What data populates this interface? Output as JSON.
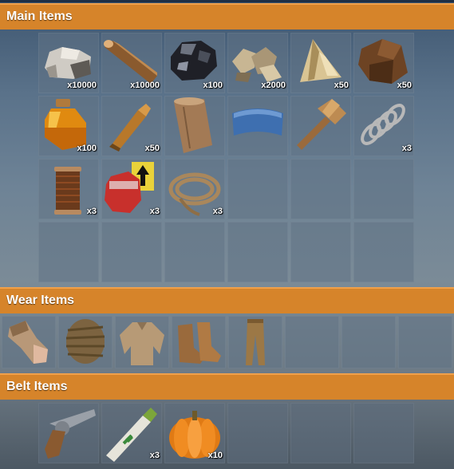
{
  "sections": {
    "main": {
      "title": "Main Items"
    },
    "wear": {
      "title": "Wear Items"
    },
    "belt": {
      "title": "Belt Items"
    }
  },
  "main_items": [
    {
      "icon": "stone-icon",
      "qty": "x10000"
    },
    {
      "icon": "wood-icon",
      "qty": "x10000"
    },
    {
      "icon": "coal-icon",
      "qty": "x100"
    },
    {
      "icon": "bone-fragments-icon",
      "qty": "x2000"
    },
    {
      "icon": "animal-fat-icon",
      "qty": "x50"
    },
    {
      "icon": "leather-icon",
      "qty": "x50"
    },
    {
      "icon": "low-grade-fuel-icon",
      "qty": "x100"
    },
    {
      "icon": "pistol-bullet-icon",
      "qty": "x50"
    },
    {
      "icon": "wood-log-icon",
      "qty": ""
    },
    {
      "icon": "metal-blade-icon",
      "qty": ""
    },
    {
      "icon": "hammer-icon",
      "qty": ""
    },
    {
      "icon": "spring-icon",
      "qty": "x3"
    },
    {
      "icon": "sewing-kit-icon",
      "qty": "x3"
    },
    {
      "icon": "road-signs-icon",
      "qty": "x3"
    },
    {
      "icon": "rope-icon",
      "qty": "x3"
    }
  ],
  "wear_items": [
    {
      "icon": "burlap-gloves-icon"
    },
    {
      "icon": "burlap-headwrap-icon"
    },
    {
      "icon": "burlap-shirt-icon"
    },
    {
      "icon": "burlap-shoes-icon"
    },
    {
      "icon": "burlap-trousers-icon"
    }
  ],
  "belt_items": [
    {
      "icon": "revolver-icon",
      "qty": ""
    },
    {
      "icon": "medical-syringe-icon",
      "qty": "x3"
    },
    {
      "icon": "pumpkin-icon",
      "qty": "x10"
    }
  ],
  "colors": {
    "header": "#d6842a",
    "slot": "#607285"
  }
}
